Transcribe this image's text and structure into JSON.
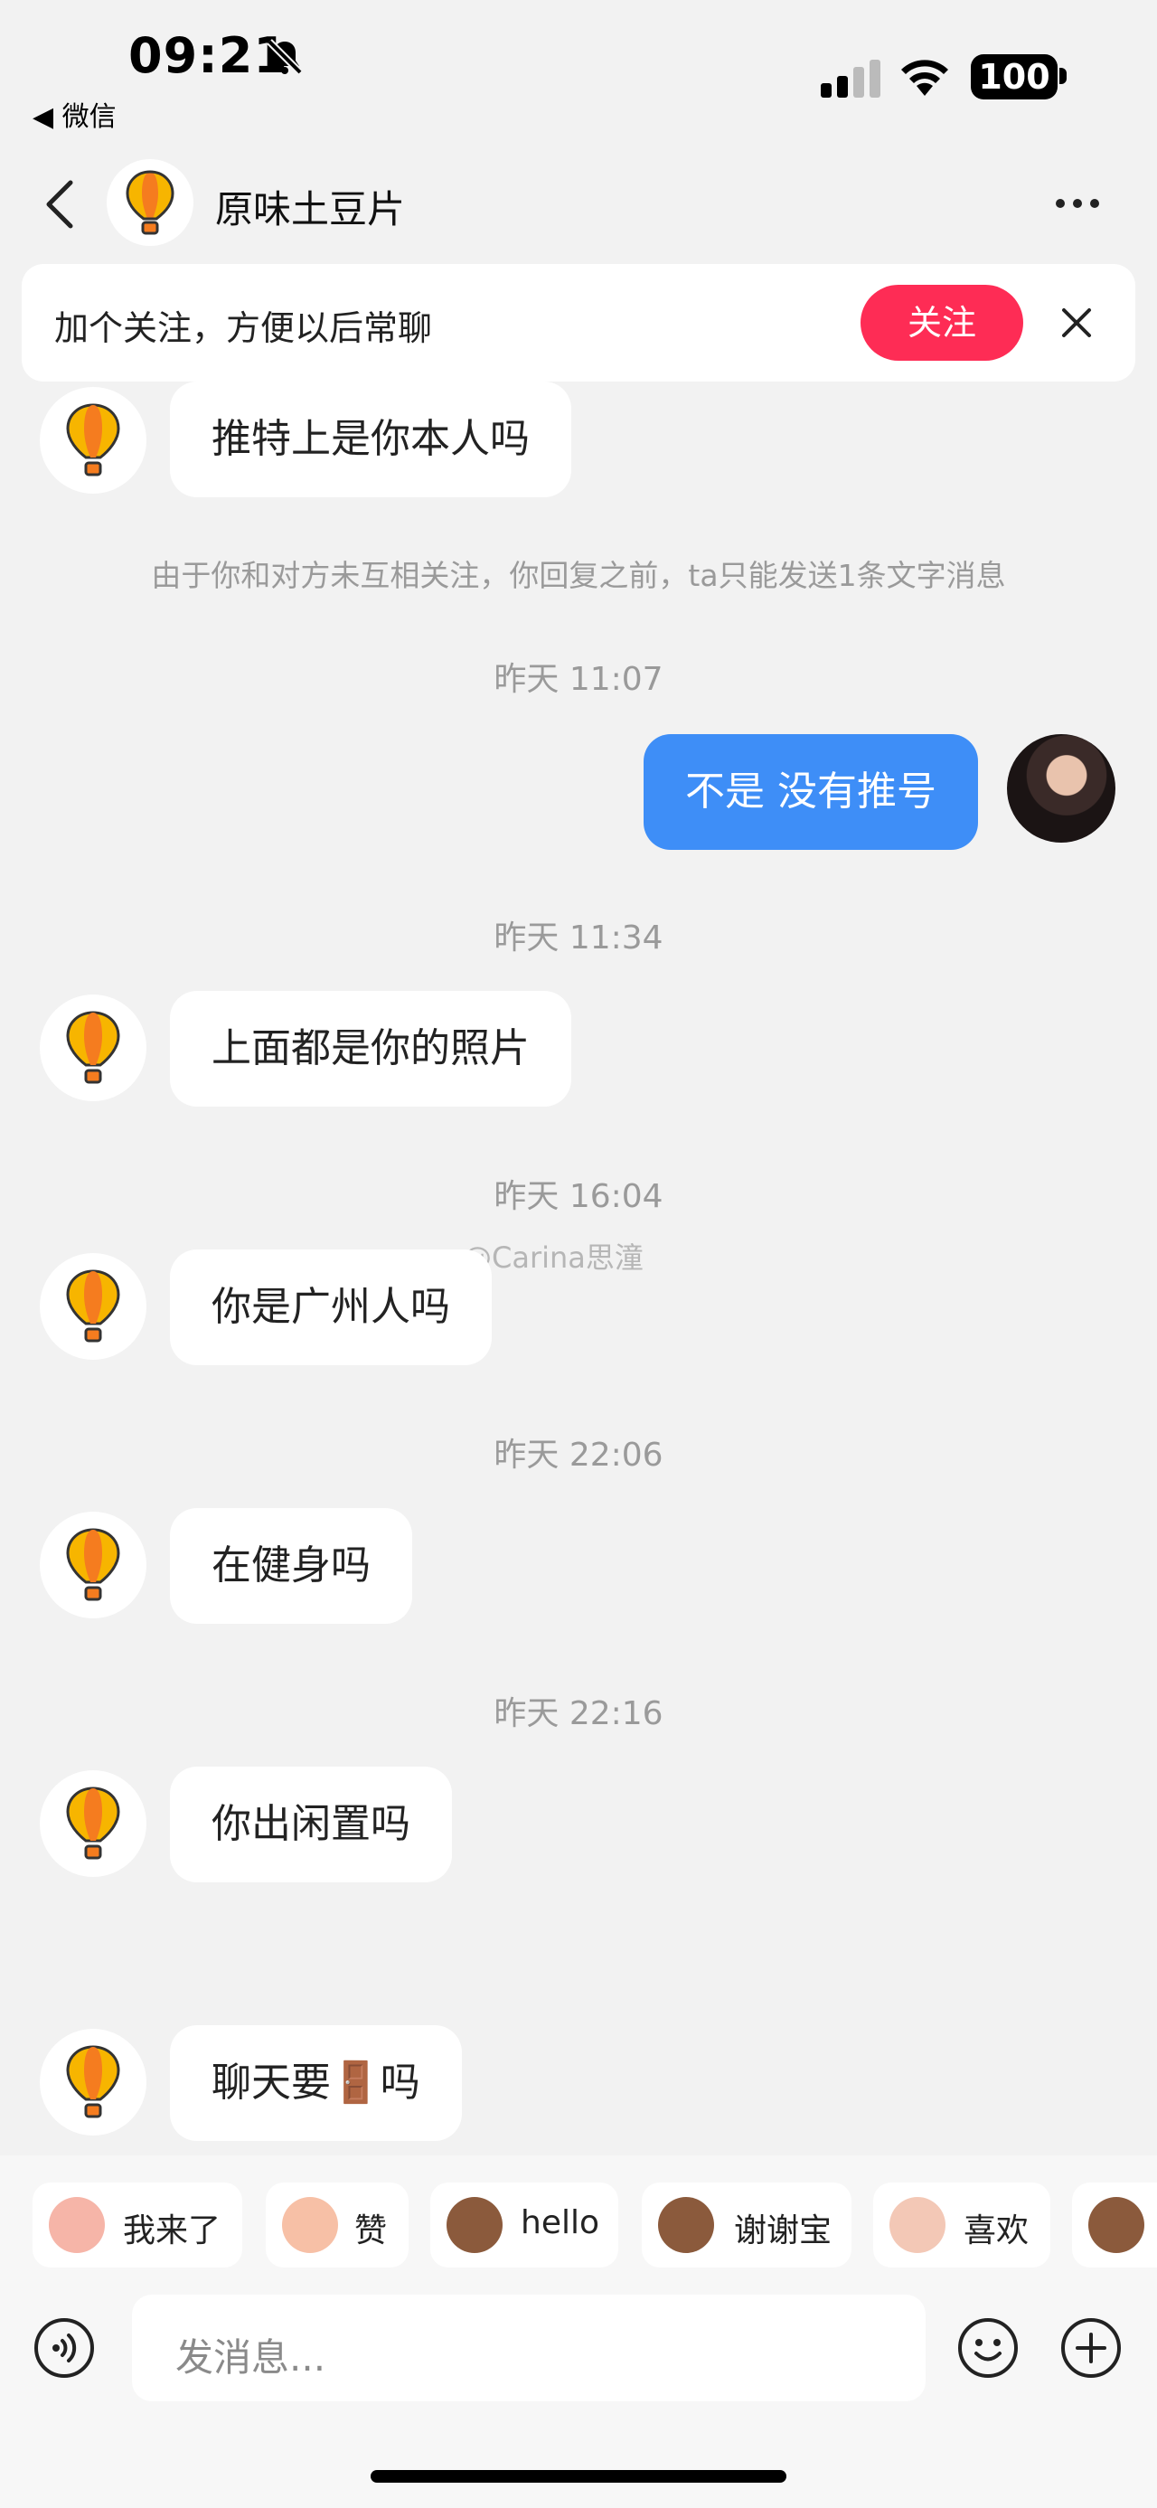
{
  "status": {
    "time": "09:21",
    "back_app": "◀ 微信",
    "battery": "100"
  },
  "header": {
    "title": "原味土豆片"
  },
  "follow_banner": {
    "text": "加个关注，方便以后常聊",
    "button": "关注"
  },
  "notice": "由于你和对方未互相关注，你回复之前，ta只能发送1条文字消息",
  "messages": [
    {
      "from": "them",
      "text": "推特上是你本人吗"
    },
    {
      "time": "昨天 11:07"
    },
    {
      "from": "me",
      "text": "不是 没有推号"
    },
    {
      "time": "昨天 11:34"
    },
    {
      "from": "them",
      "text": "上面都是你的照片"
    },
    {
      "time": "昨天 16:04"
    },
    {
      "from": "them",
      "text": "你是广州人吗"
    },
    {
      "time": "昨天 22:06"
    },
    {
      "from": "them",
      "text": "在健身吗"
    },
    {
      "time": "昨天 22:16"
    },
    {
      "from": "them",
      "text": "你出闲置吗"
    },
    {
      "from": "them",
      "text": "聊天要🚪吗"
    }
  ],
  "watermark": "@Carina思潼",
  "quick_replies": [
    {
      "label": "我来了",
      "color": "#f6b5a8"
    },
    {
      "label": "赞",
      "color": "#f7c0a6"
    },
    {
      "label": "hello",
      "color": "#8b5a3c"
    },
    {
      "label": "谢谢宝",
      "color": "#8b5a3c"
    },
    {
      "label": "喜欢",
      "color": "#f3c8b6"
    },
    {
      "label": "",
      "color": "#8b5a3c"
    }
  ],
  "input": {
    "placeholder": "发消息..."
  },
  "icons": {
    "avatar": "hot-air-balloon-icon",
    "voice": "voice-icon",
    "emoji": "emoji-icon",
    "plus": "plus-icon"
  }
}
